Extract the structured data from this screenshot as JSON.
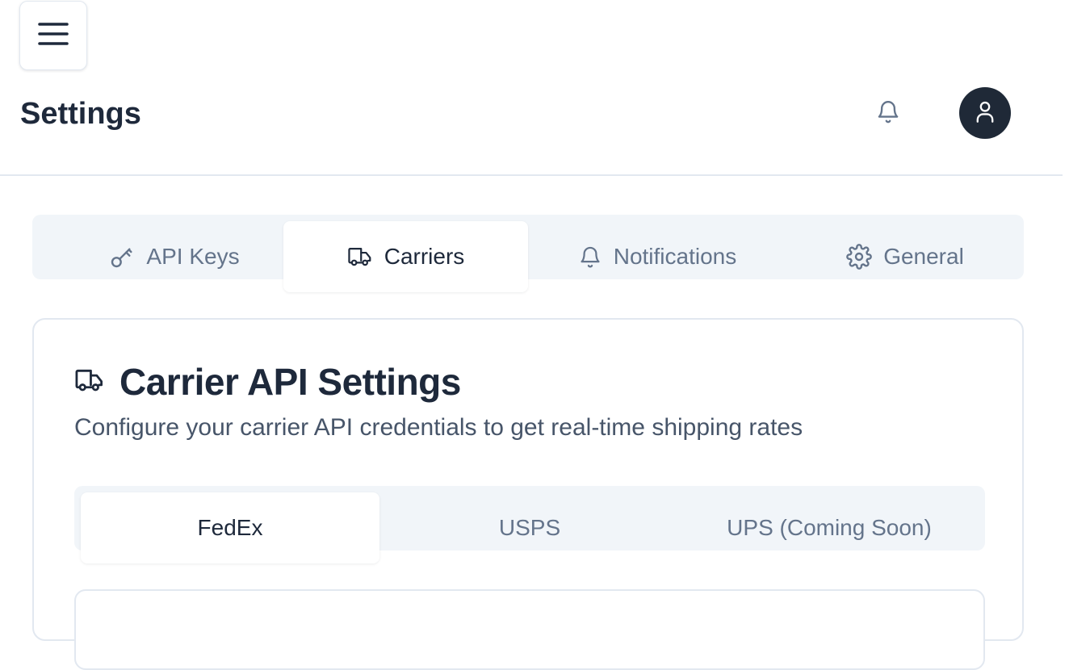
{
  "header": {
    "title": "Settings",
    "menu_icon": "menu-icon",
    "notification_icon": "bell-icon",
    "avatar_icon": "user-icon"
  },
  "main_tabs": [
    {
      "label": "API Keys",
      "icon": "key-icon",
      "active": false
    },
    {
      "label": "Carriers",
      "icon": "truck-icon",
      "active": true
    },
    {
      "label": "Notifications",
      "icon": "bell-icon",
      "active": false
    },
    {
      "label": "General",
      "icon": "gear-icon",
      "active": false
    }
  ],
  "card": {
    "title": "Carrier API Settings",
    "title_icon": "truck-icon",
    "description": "Configure your carrier API credentials to get real-time shipping rates"
  },
  "carrier_tabs": [
    {
      "label": "FedEx",
      "active": true
    },
    {
      "label": "USPS",
      "active": false
    },
    {
      "label": "UPS (Coming Soon)",
      "active": false
    }
  ],
  "colors": {
    "text_primary": "#1e293b",
    "text_muted": "#64748b",
    "tab_track": "#f1f5f9",
    "avatar_bg": "#1f2937",
    "border": "#e2e8f0"
  }
}
